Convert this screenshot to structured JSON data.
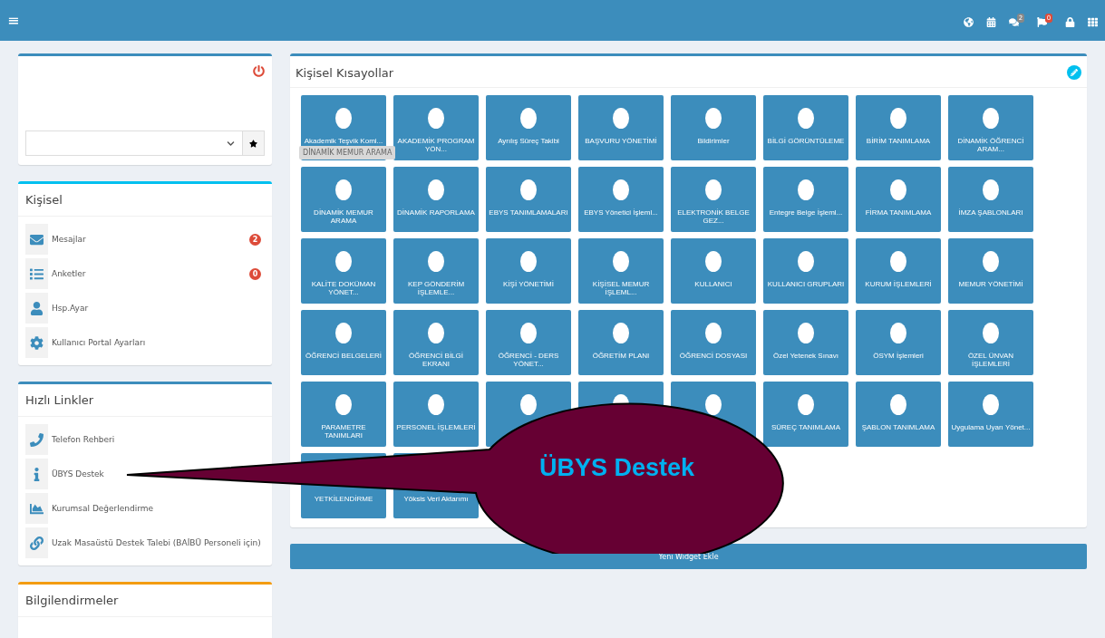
{
  "header": {
    "menu_icon": "≡",
    "icons": [
      {
        "kind": "globe"
      },
      {
        "kind": "calendar"
      },
      {
        "kind": "comments",
        "badge": "2"
      },
      {
        "kind": "flag",
        "badge": "0"
      },
      {
        "kind": "lock"
      },
      {
        "kind": "grid"
      }
    ]
  },
  "personal_panel": {
    "title": "Kişisel",
    "items": [
      {
        "kind": "mail",
        "label": "Mesajlar",
        "badge": "2"
      },
      {
        "kind": "list",
        "label": "Anketler",
        "badge": "0"
      },
      {
        "kind": "user",
        "label": "Hsp.Ayar"
      },
      {
        "kind": "gear",
        "label": "Kullanıcı Portal Ayarları"
      }
    ]
  },
  "quick_links": {
    "title": "Hızlı Linkler",
    "items": [
      {
        "kind": "phone",
        "label": "Telefon Rehberi"
      },
      {
        "kind": "info",
        "label": "ÜBYS Destek"
      },
      {
        "kind": "chart",
        "label": "Kurumsal Değerlendirme"
      },
      {
        "kind": "link",
        "label": "Uzak Masaüstü Destek Talebi (BAİBÜ Personeli için)"
      }
    ]
  },
  "notifications_panel": {
    "title": "Bilgilendirmeler"
  },
  "shortcuts": {
    "title": "Kişisel Kısayollar",
    "tooltip": "DİNAMİK MEMUR ARAMA",
    "tiles": [
      {
        "label": "Akademik Teşvik Komi..."
      },
      {
        "label": "AKADEMİK PROGRAM YÖN..."
      },
      {
        "label": "Ayrılış Süreç Takibi"
      },
      {
        "label": "BAŞVURU YÖNETİMİ"
      },
      {
        "label": "Bildirimler"
      },
      {
        "label": "BİLGİ GÖRÜNTÜLEME"
      },
      {
        "label": "BİRİM TANIMLAMA"
      },
      {
        "label": "DİNAMİK ÖĞRENCİ ARAM..."
      },
      {
        "label": "DİNAMİK MEMUR ARAMA"
      },
      {
        "label": "DİNAMİK RAPORLAMA"
      },
      {
        "label": "EBYS TANIMLAMALARI"
      },
      {
        "label": "EBYS Yönetici İşleml..."
      },
      {
        "label": "ELEKTRONİK BELGE GEZ..."
      },
      {
        "label": "Entegre Belge İşleml..."
      },
      {
        "label": "FİRMA TANIMLAMA"
      },
      {
        "label": "İMZA ŞABLONLARI"
      },
      {
        "label": "KALİTE DOKÜMAN YÖNET..."
      },
      {
        "label": "KEP GÖNDERİM İŞLEMLE..."
      },
      {
        "label": "KİŞİ YÖNETİMİ"
      },
      {
        "label": "KİŞİSEL MEMUR İŞLEML..."
      },
      {
        "label": "KULLANICI"
      },
      {
        "label": "KULLANICI GRUPLARI"
      },
      {
        "label": "KURUM İŞLEMLERİ"
      },
      {
        "label": "MEMUR YÖNETİMİ"
      },
      {
        "label": "ÖĞRENCİ BELGELERİ"
      },
      {
        "label": "ÖĞRENCİ BİLGİ EKRANI"
      },
      {
        "label": "ÖĞRENCİ - DERS YÖNET..."
      },
      {
        "label": "ÖĞRETİM PLANI"
      },
      {
        "label": "ÖĞRENCİ DOSYASI"
      },
      {
        "label": "Özel Yetenek Sınavı"
      },
      {
        "label": "ÖSYM İşlemleri"
      },
      {
        "label": "ÖZEL ÜNVAN İŞLEMLERİ"
      },
      {
        "label": "PARAMETRE TANIMLARI"
      },
      {
        "label": "PERSONEL İŞLEMLERİ"
      },
      {
        "kind": "covered"
      },
      {
        "kind": "covered"
      },
      {
        "kind": "covered"
      },
      {
        "label": "SÜREÇ TANIMLAMA"
      },
      {
        "label": "ŞABLON TANIMLAMA"
      },
      {
        "label": "Uygulama Uyarı Yönet..."
      },
      {
        "label": "YETKİLENDİRME"
      },
      {
        "label": "Yöksis Veri Aktarımı"
      }
    ]
  },
  "add_widget_button": "Yeni Widget Ekle",
  "callout": {
    "text": "ÜBYS Destek"
  }
}
